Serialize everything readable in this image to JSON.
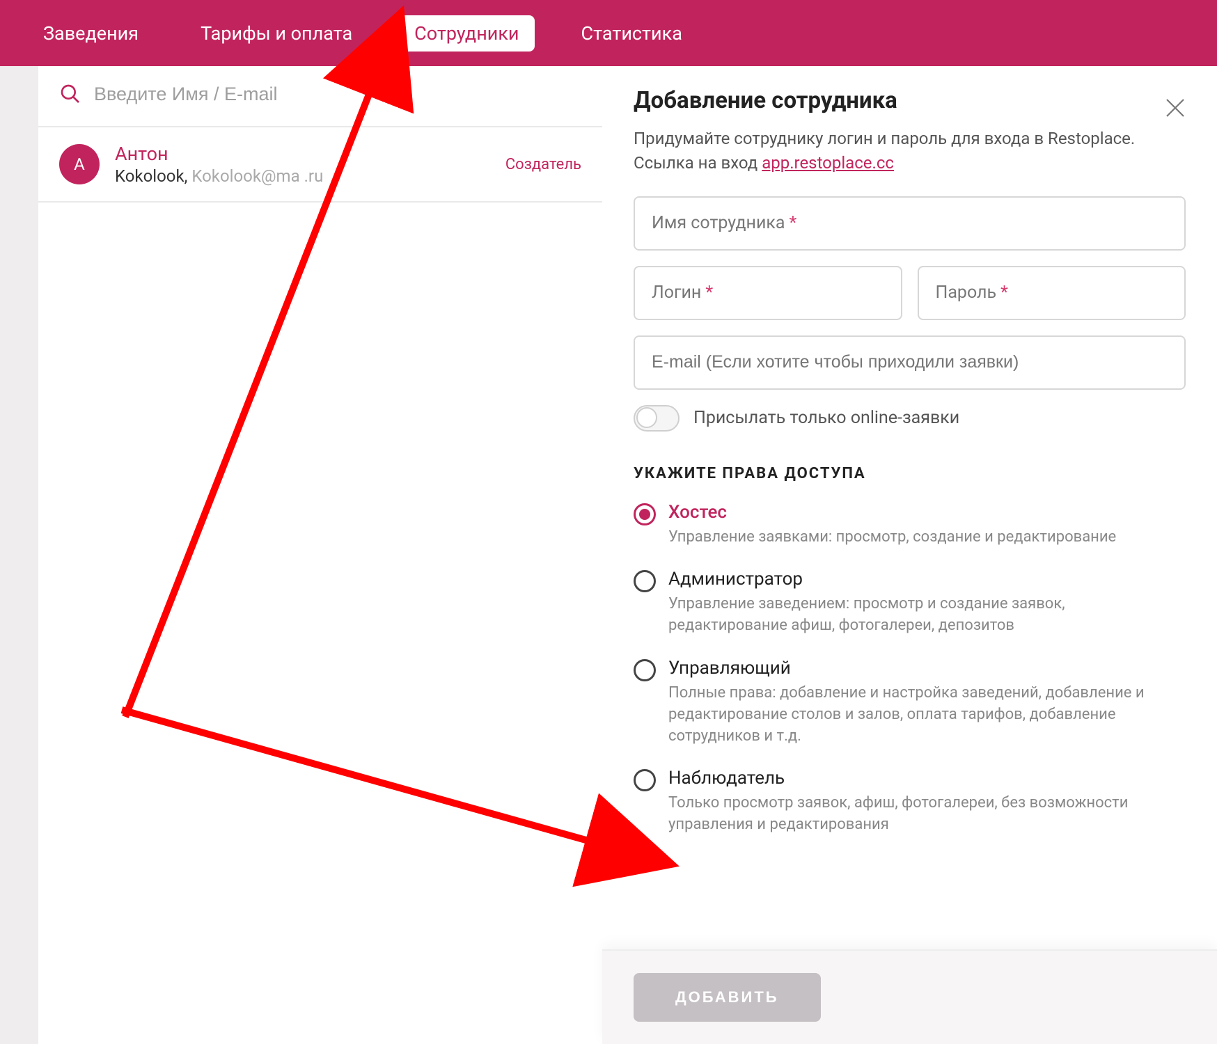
{
  "nav": {
    "items": [
      "Заведения",
      "Тарифы и оплата",
      "Сотрудники",
      "Статистика"
    ],
    "active_index": 2
  },
  "search": {
    "placeholder": "Введите Имя / E-mail"
  },
  "employees": [
    {
      "initial": "А",
      "name": "Антон",
      "org": "Kokolook, ",
      "email": "Kokolook@ma  .ru",
      "role": "Создатель"
    }
  ],
  "panel": {
    "title": "Добавление сотрудника",
    "desc_prefix": "Придумайте сотруднику логин и пароль для входа в Restoplace. Ссылка на вход ",
    "desc_link": "app.restoplace.cc",
    "fields": {
      "name_label": "Имя сотрудника",
      "login_label": "Логин",
      "password_label": "Пароль",
      "email_placeholder": "E-mail (Если хотите чтобы приходили заявки)"
    },
    "toggle_label": "Присылать только online-заявки",
    "rights_header": "УКАЖИТЕ ПРАВА ДОСТУПА",
    "roles": [
      {
        "title": "Хостес",
        "desc": "Управление заявками: просмотр, создание и редактирование",
        "selected": true
      },
      {
        "title": "Администратор",
        "desc": "Управление заведением: просмотр и создание заявок, редактирование афиш, фотогалереи, депозитов",
        "selected": false
      },
      {
        "title": "Управляющий",
        "desc": "Полные права: добавление и настройка заведений, добавление и редактирование столов и залов, оплата тарифов, добавление сотрудников и т.д.",
        "selected": false
      },
      {
        "title": "Наблюдатель",
        "desc": "Только просмотр заявок, афиш, фотогалереи, без возможности управления и редактирования",
        "selected": false
      }
    ],
    "submit_label": "ДОБАВИТЬ"
  },
  "colors": {
    "accent": "#c1245d"
  }
}
